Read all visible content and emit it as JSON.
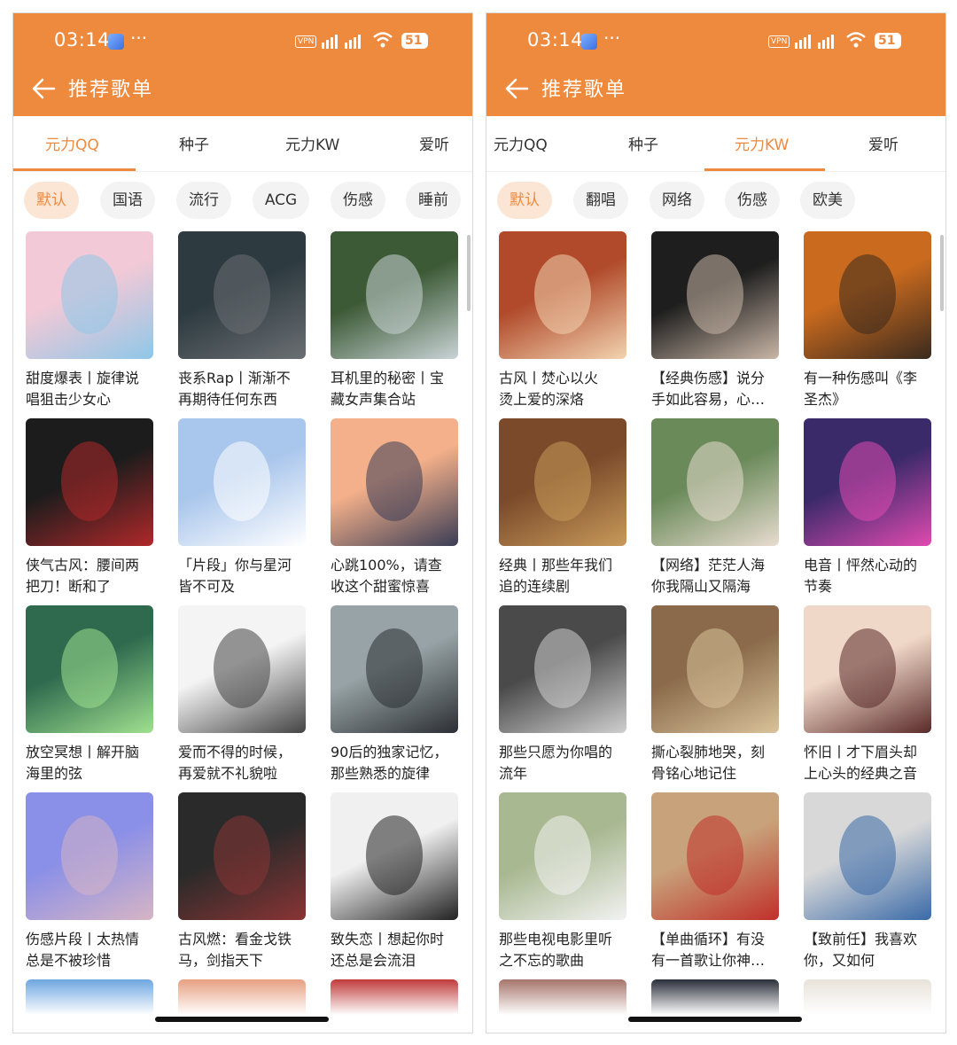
{
  "status_bar": {
    "time": "03:14",
    "dots": "···",
    "vpn": "VPN",
    "battery": "51"
  },
  "header": {
    "title": "推荐歌单"
  },
  "colors": {
    "accent": "#ee8a3e",
    "chip_active_bg": "#fbe6d6",
    "chip_bg": "#f3f3f3"
  },
  "icons": {
    "back": "arrow-left-icon",
    "wifi": "wifi-icon",
    "signal": "signal-icon",
    "battery": "battery-icon"
  },
  "left": {
    "tabs": [
      {
        "label": "元力QQ",
        "active": true
      },
      {
        "label": "种子",
        "active": false
      },
      {
        "label": "元力KW",
        "active": false
      },
      {
        "label": "爱听",
        "active": false
      }
    ],
    "chips": [
      {
        "label": "默认",
        "active": true
      },
      {
        "label": "国语",
        "active": false
      },
      {
        "label": "流行",
        "active": false
      },
      {
        "label": "ACG",
        "active": false
      },
      {
        "label": "伤感",
        "active": false
      },
      {
        "label": "睡前",
        "active": false
      }
    ],
    "playlists": [
      {
        "line1": "甜度爆表丨旋律说",
        "line2": "唱狙击少女心",
        "colors": [
          "#f2c9d6",
          "#8fc7e8"
        ]
      },
      {
        "line1": "丧系Rap丨渐渐不",
        "line2": "再期待任何东西",
        "colors": [
          "#2d3a40",
          "#6b6f73"
        ]
      },
      {
        "line1": "耳机里的秘密丨宝",
        "line2": "藏女声集合站",
        "colors": [
          "#3d5a36",
          "#c9d3d6"
        ]
      },
      {
        "line1": "侠气古风：腰间两",
        "line2": "把刀！断和了",
        "colors": [
          "#1c1c1c",
          "#b0282a"
        ]
      },
      {
        "line1": "「片段」你与星河",
        "line2": "皆不可及",
        "colors": [
          "#a9c6ec",
          "#ffffff"
        ]
      },
      {
        "line1": "心跳100%，请查",
        "line2": "收这个甜蜜惊喜",
        "colors": [
          "#f4b08a",
          "#3a3d55"
        ]
      },
      {
        "line1": "放空冥想丨解开脑",
        "line2": "海里的弦",
        "colors": [
          "#2f6a4e",
          "#9fe08f"
        ]
      },
      {
        "line1": "爱而不得的时候，",
        "line2": "再爱就不礼貌啦",
        "colors": [
          "#f4f4f4",
          "#444444"
        ]
      },
      {
        "line1": "90后的独家记忆，",
        "line2": "那些熟悉的旋律",
        "colors": [
          "#97a3a6",
          "#2c2f33"
        ]
      },
      {
        "line1": "伤感片段丨太热情",
        "line2": "总是不被珍惜",
        "colors": [
          "#8a8fe8",
          "#d6b5c4"
        ]
      },
      {
        "line1": "古风燃：看金戈铁",
        "line2": "马，剑指天下",
        "colors": [
          "#2a2a2a",
          "#8a3434"
        ]
      },
      {
        "line1": "致失恋丨想起你时",
        "line2": "还总是会流泪",
        "colors": [
          "#f0f0f0",
          "#222222"
        ]
      }
    ],
    "partial_colors": [
      "#6ea6e0",
      "#e7a081",
      "#c03a3a"
    ]
  },
  "right": {
    "tabs": [
      {
        "label": "元力QQ",
        "active": false
      },
      {
        "label": "种子",
        "active": false
      },
      {
        "label": "元力KW",
        "active": true
      },
      {
        "label": "爱听",
        "active": false
      }
    ],
    "chips": [
      {
        "label": "默认",
        "active": true
      },
      {
        "label": "翻唱",
        "active": false
      },
      {
        "label": "网络",
        "active": false
      },
      {
        "label": "伤感",
        "active": false
      },
      {
        "label": "欧美",
        "active": false
      }
    ],
    "playlists": [
      {
        "line1": "古风丨焚心以火",
        "line2": "烫上爱的深烙",
        "colors": [
          "#b04a2a",
          "#f2d3b0"
        ]
      },
      {
        "line1": "【经典伤感】说分",
        "line2": "手如此容易，心…",
        "colors": [
          "#1e1e1e",
          "#c9b6a6"
        ]
      },
      {
        "line1": "有一种伤感叫《李",
        "line2": "圣杰》",
        "colors": [
          "#c96a1e",
          "#3a2a1e"
        ]
      },
      {
        "line1": "经典丨那些年我们",
        "line2": "追的连续剧",
        "colors": [
          "#7a4a2a",
          "#c79a5a"
        ]
      },
      {
        "line1": "【网络】茫茫人海",
        "line2": "你我隔山又隔海",
        "colors": [
          "#6a8a5a",
          "#e8dcd0"
        ]
      },
      {
        "line1": "电音丨怦然心动的",
        "line2": "节奏",
        "colors": [
          "#3a2a6a",
          "#e04ab0"
        ]
      },
      {
        "line1": "那些只愿为你唱的",
        "line2": "流年",
        "colors": [
          "#4a4a4a",
          "#cfcfcf"
        ]
      },
      {
        "line1": "撕心裂肺地哭，刻",
        "line2": "骨铭心地记住",
        "colors": [
          "#8a6a4a",
          "#d9c29a"
        ]
      },
      {
        "line1": "怀旧丨才下眉头却",
        "line2": "上心头的经典之音",
        "colors": [
          "#f0d8c8",
          "#5a2a2a"
        ]
      },
      {
        "line1": "那些电视电影里听",
        "line2": "之不忘的歌曲",
        "colors": [
          "#a8b890",
          "#f2f2f2"
        ]
      },
      {
        "line1": "【单曲循环】有没",
        "line2": "有一首歌让你神…",
        "colors": [
          "#c8a27a",
          "#c0302a"
        ]
      },
      {
        "line1": "【致前任】我喜欢",
        "line2": "你，又如何",
        "colors": [
          "#d8d8d8",
          "#3a6aa8"
        ]
      }
    ],
    "partial_colors": [
      "#a6756a",
      "#2a2e3a",
      "#e8e2da"
    ]
  }
}
